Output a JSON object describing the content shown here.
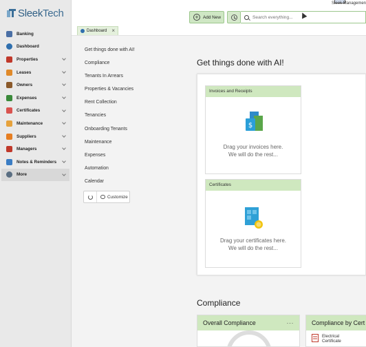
{
  "app": {
    "logo_part1": "Sleek",
    "logo_part2": "Tech",
    "window_title": "Sleek Managemen"
  },
  "sidebar": {
    "items": [
      {
        "label": "Banking",
        "icon": "bank-icon",
        "color": "#4a6fa5",
        "chevron": false
      },
      {
        "label": "Dashboard",
        "icon": "dashboard-icon",
        "color": "#2f6fae",
        "chevron": false
      },
      {
        "label": "Properties",
        "icon": "properties-icon",
        "color": "#c0392b",
        "chevron": true
      },
      {
        "label": "Leases",
        "icon": "leases-icon",
        "color": "#e08a2a",
        "chevron": true
      },
      {
        "label": "Owners",
        "icon": "owners-icon",
        "color": "#8b5a2b",
        "chevron": true
      },
      {
        "label": "Expenses",
        "icon": "expenses-icon",
        "color": "#3a8a3a",
        "chevron": true
      },
      {
        "label": "Certificates",
        "icon": "certificates-icon",
        "color": "#d9534f",
        "chevron": true
      },
      {
        "label": "Maintenance",
        "icon": "maintenance-icon",
        "color": "#e6a23c",
        "chevron": true
      },
      {
        "label": "Suppliers",
        "icon": "suppliers-icon",
        "color": "#e67e22",
        "chevron": true
      },
      {
        "label": "Managers",
        "icon": "managers-icon",
        "color": "#c0392b",
        "chevron": true
      },
      {
        "label": "Notes & Reminders",
        "icon": "notes-icon",
        "color": "#3b7dc4",
        "chevron": true
      },
      {
        "label": "More",
        "icon": "gear-icon",
        "color": "#5a6e82",
        "chevron": true,
        "active": true
      }
    ]
  },
  "toolbar": {
    "add_new_label": "Add New",
    "search_placeholder": "Search everything..."
  },
  "tabs": [
    {
      "label": "Dashboard"
    }
  ],
  "quick_links": {
    "items": [
      "Get things done with AI!",
      "Compliance",
      "Tenants In Arrears",
      "Properties & Vacancies",
      "Rent Collection",
      "Tenancies",
      "Onboarding Tenants",
      "Maintenance",
      "Expenses",
      "Automation",
      "Calendar"
    ],
    "customize_label": "Customize"
  },
  "ai_section": {
    "title": "Get things done with AI!",
    "cards": [
      {
        "header": "Invoices and Receipts",
        "line1": "Drag your invoices here.",
        "line2": "We will do the rest..."
      },
      {
        "header": "Certificates",
        "line1": "Drag your certificates here.",
        "line2": "We will do the rest..."
      }
    ]
  },
  "compliance": {
    "title": "Compliance",
    "overall_title": "Overall Compliance",
    "more_label": "···",
    "by_cert_title": "Compliance by Cert",
    "electrical_label_1": "Electrical",
    "electrical_label_2": "Certificate"
  }
}
